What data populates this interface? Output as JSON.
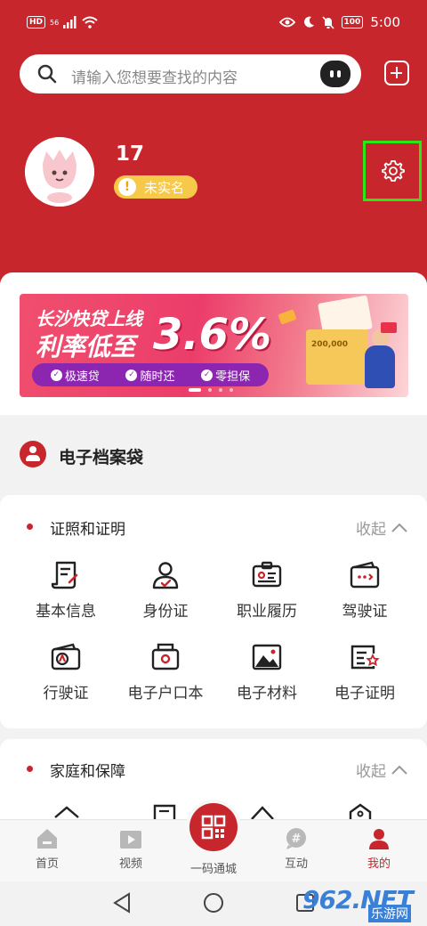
{
  "status_bar": {
    "network_badge": "HD",
    "signal_label": "56",
    "battery": "100",
    "time": "5:00"
  },
  "search": {
    "placeholder": "请输入您想要查找的内容"
  },
  "profile": {
    "user_number": "17",
    "verify_status": "未实名"
  },
  "banner": {
    "title": "长沙快贷上线",
    "rate_label": "利率低至",
    "rate_value": "3.6%",
    "features": [
      "极速贷",
      "随时还",
      "零担保"
    ],
    "box_label": "200,000"
  },
  "archive": {
    "title": "电子档案袋"
  },
  "sections": [
    {
      "title": "证照和证明",
      "collapse_label": "收起",
      "items": [
        {
          "label": "基本信息",
          "icon": "document-scroll-icon"
        },
        {
          "label": "身份证",
          "icon": "id-person-icon"
        },
        {
          "label": "职业履历",
          "icon": "work-badge-icon"
        },
        {
          "label": "驾驶证",
          "icon": "driver-license-icon"
        },
        {
          "label": "行驶证",
          "icon": "vehicle-license-icon"
        },
        {
          "label": "电子户口本",
          "icon": "household-register-icon"
        },
        {
          "label": "电子材料",
          "icon": "image-material-icon"
        },
        {
          "label": "电子证明",
          "icon": "certificate-star-icon"
        }
      ]
    },
    {
      "title": "家庭和保障",
      "collapse_label": "收起"
    }
  ],
  "bottom_nav": {
    "items": [
      {
        "label": "首页",
        "icon": "home-icon"
      },
      {
        "label": "视频",
        "icon": "video-icon"
      },
      {
        "label": "一码通城",
        "icon": "qr-code-icon"
      },
      {
        "label": "互动",
        "icon": "chat-hash-icon"
      },
      {
        "label": "我的",
        "icon": "person-icon"
      }
    ],
    "active_color": "#c8262d"
  },
  "watermark": {
    "main": "962.NET",
    "sub": "乐游网"
  },
  "colors": {
    "brand_red": "#c8262d",
    "highlight_green": "#2de616",
    "verify_yellow": "#f7c94a"
  }
}
